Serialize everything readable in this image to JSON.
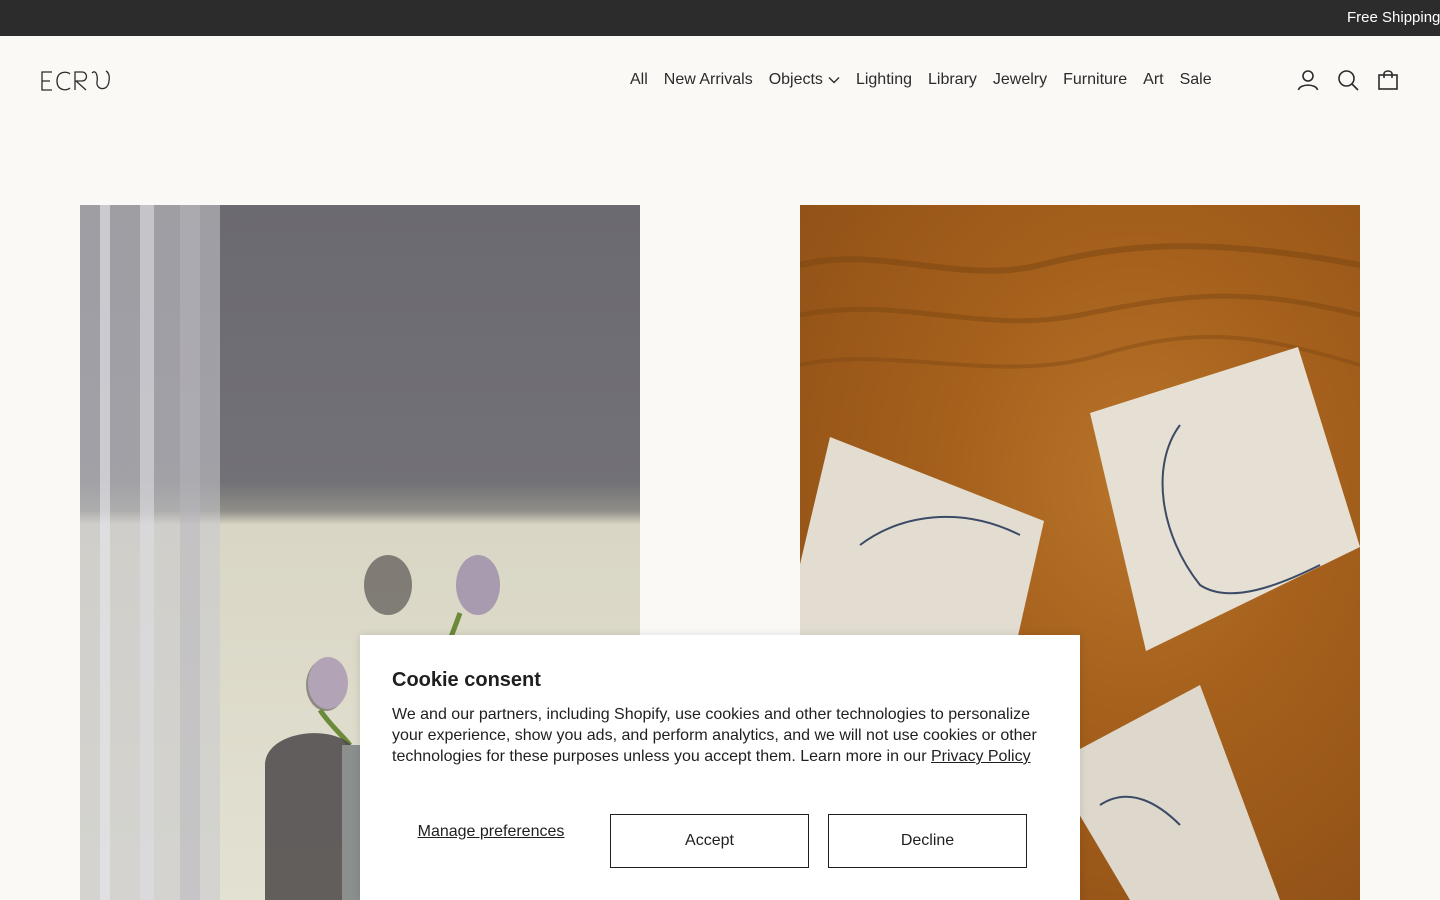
{
  "announcement": {
    "text": "Free Shipping"
  },
  "brand": {
    "logo_text": "ECRU"
  },
  "nav": {
    "items": [
      {
        "label": "All"
      },
      {
        "label": "New Arrivals"
      },
      {
        "label": "Objects",
        "has_dropdown": true
      },
      {
        "label": "Lighting"
      },
      {
        "label": "Library"
      },
      {
        "label": "Jewelry"
      },
      {
        "label": "Furniture"
      },
      {
        "label": "Art"
      },
      {
        "label": "Sale"
      }
    ]
  },
  "header_icons": [
    "account-icon",
    "search-icon",
    "cart-icon"
  ],
  "colors": {
    "announcement_bg": "#2c2c2c",
    "page_bg": "#faf9f6",
    "text": "#2b2b2b"
  },
  "consent": {
    "title": "Cookie consent",
    "body": "We and our partners, including Shopify, use cookies and other technologies to personalize your experience, show you ads, and perform analytics, and we will not use cookies or other technologies for these purposes unless you accept them. Learn more in our ",
    "link": "Privacy Policy",
    "manage": "Manage preferences",
    "accept": "Accept",
    "decline": "Decline"
  }
}
